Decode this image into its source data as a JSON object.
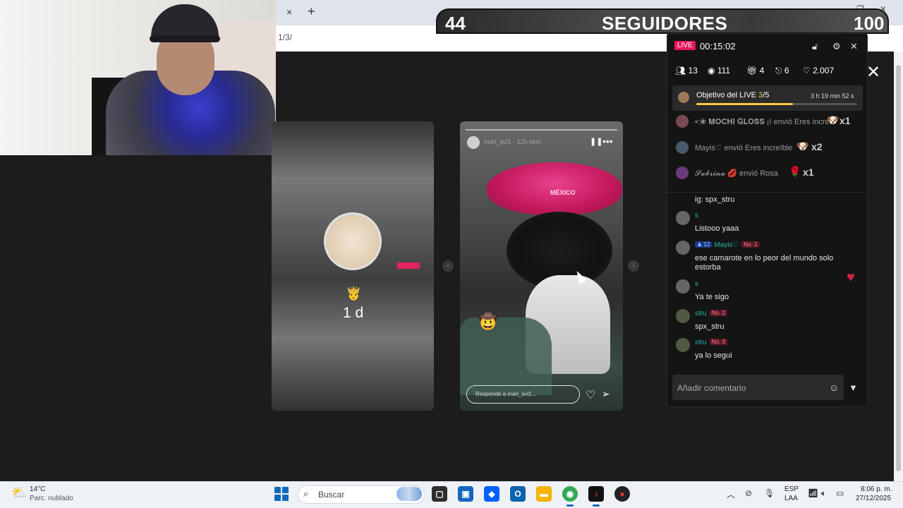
{
  "browser": {
    "tab_close_icon": "×",
    "new_tab_icon": "+",
    "url_fragment": "1/3/",
    "window_controls": [
      "—",
      "❐",
      "✕"
    ]
  },
  "banner": {
    "current": "44",
    "label": "SEGUIDORES",
    "target": "100"
  },
  "story": {
    "time_ago": "1 d",
    "user": "mari_svl1 · 12h sem",
    "reply_placeholder": "Responde a mari_svl1...",
    "hat_text": "MÉXICO",
    "prev_icon": "‹",
    "next_icon": "›"
  },
  "live_panel": {
    "badge": "LIVE",
    "timer": "00:15:02",
    "stats": {
      "members": "13",
      "viewers": "111",
      "gifts": "4",
      "shares": "6",
      "likes": "2.007"
    },
    "goal": {
      "label": "Objetivo del LIVE",
      "current": "3",
      "separator": "/",
      "target": "5",
      "progress": 0.6,
      "time_left": "3 h 19 min 52 s"
    },
    "gifts": [
      {
        "text": "•:❀ 𝐌𝐎𝐂𝐇𝐈 𝐆𝐋𝐎𝐒𝐒 ¡! envió Eres increíb",
        "multiplier": "x1"
      },
      {
        "text": "Mayis♡ envió Eres increíble",
        "multiplier": "x2"
      },
      {
        "text": "𝓢𝓪𝓫𝓻𝓲𝓷𝓪 💋 envió Rosa",
        "multiplier": "x1"
      }
    ],
    "chat": [
      {
        "name": "",
        "level": "",
        "rank": "",
        "message": "ig: spx_stru"
      },
      {
        "name": "s",
        "level": "",
        "rank": "",
        "message": "Listooo yaaa"
      },
      {
        "name": "Mayis♡",
        "level": "12",
        "rank": "No. 1",
        "message": "ese camarote en lo peor del mundo solo estorba"
      },
      {
        "name": "s",
        "level": "",
        "rank": "",
        "message": "Ya te sigo"
      },
      {
        "name": "stru",
        "level": "",
        "rank": "No. 2",
        "message": "spx_stru"
      },
      {
        "name": "stru",
        "level": "",
        "rank": "No. 3",
        "message": "ya lo segui"
      }
    ],
    "comment_placeholder": "Añadir comentario"
  },
  "taskbar": {
    "temperature": "14°C",
    "weather": "Parc. nublado",
    "search_label": "Buscar",
    "lang_line1": "ESP",
    "lang_line2": "LAA",
    "time": "8:06 p. m.",
    "date": "27/12/2025"
  },
  "colors": {
    "live_pink": "#e8175d",
    "goal_yellow": "#f7c948",
    "chat_name_teal": "#29b6a8",
    "taskbar_bg": "#eef2f7",
    "start_blue": "#0f6cbd"
  }
}
